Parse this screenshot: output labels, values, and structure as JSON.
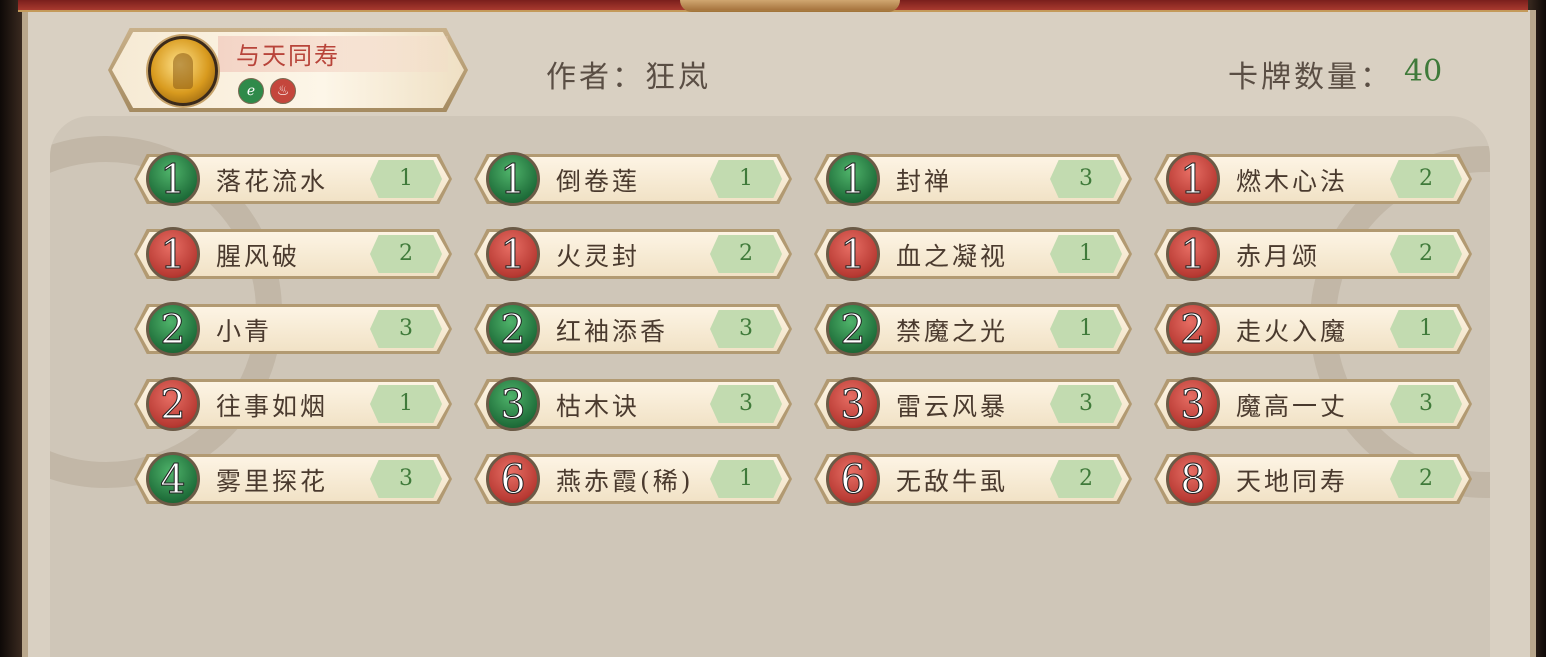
{
  "deck": {
    "name": "与天同寿",
    "elements": [
      "wood",
      "fire"
    ],
    "author_text": "作者：狂岚",
    "count_label": "卡牌数量：",
    "count_value": "40"
  },
  "colors": {
    "green_cost": "#1f6e3a",
    "red_cost": "#b83a33",
    "qty_text": "#3f7a3a",
    "deck_name": "#b8443a"
  },
  "cards": [
    {
      "cost": "1",
      "color": "green",
      "name": "落花流水",
      "qty": "1"
    },
    {
      "cost": "1",
      "color": "green",
      "name": "倒卷莲",
      "qty": "1"
    },
    {
      "cost": "1",
      "color": "green",
      "name": "封禅",
      "qty": "3"
    },
    {
      "cost": "1",
      "color": "red",
      "name": "燃木心法",
      "qty": "2"
    },
    {
      "cost": "1",
      "color": "red",
      "name": "腥风破",
      "qty": "2"
    },
    {
      "cost": "1",
      "color": "red",
      "name": "火灵封",
      "qty": "2"
    },
    {
      "cost": "1",
      "color": "red",
      "name": "血之凝视",
      "qty": "1"
    },
    {
      "cost": "1",
      "color": "red",
      "name": "赤月颂",
      "qty": "2"
    },
    {
      "cost": "2",
      "color": "green",
      "name": "小青",
      "qty": "3"
    },
    {
      "cost": "2",
      "color": "green",
      "name": "红袖添香",
      "qty": "3"
    },
    {
      "cost": "2",
      "color": "green",
      "name": "禁魔之光",
      "qty": "1"
    },
    {
      "cost": "2",
      "color": "red",
      "name": "走火入魔",
      "qty": "1"
    },
    {
      "cost": "2",
      "color": "red",
      "name": "往事如烟",
      "qty": "1"
    },
    {
      "cost": "3",
      "color": "green",
      "name": "枯木诀",
      "qty": "3"
    },
    {
      "cost": "3",
      "color": "red",
      "name": "雷云风暴",
      "qty": "3"
    },
    {
      "cost": "3",
      "color": "red",
      "name": "魔高一丈",
      "qty": "3"
    },
    {
      "cost": "4",
      "color": "green",
      "name": "雾里探花",
      "qty": "3"
    },
    {
      "cost": "6",
      "color": "red",
      "name": "燕赤霞(稀)",
      "qty": "1"
    },
    {
      "cost": "6",
      "color": "red",
      "name": "无敌牛虱",
      "qty": "2"
    },
    {
      "cost": "8",
      "color": "red",
      "name": "天地同寿",
      "qty": "2"
    }
  ]
}
